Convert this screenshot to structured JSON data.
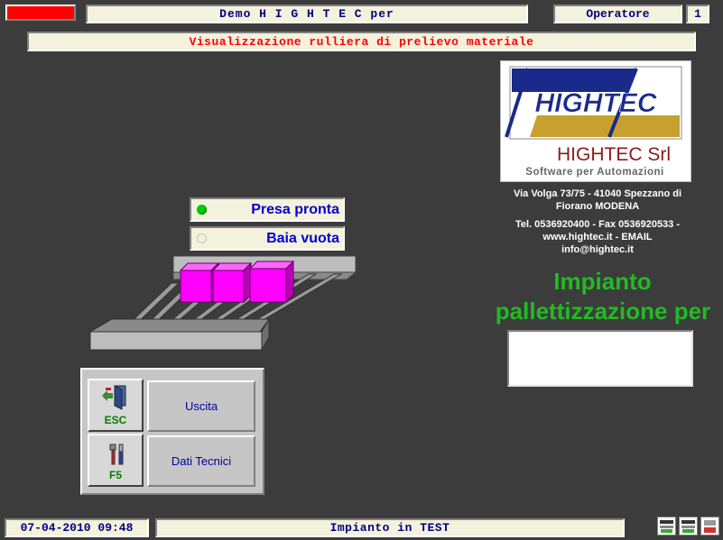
{
  "header": {
    "title": "Demo H I G H T E C per",
    "operator_label": "Operatore",
    "operator_number": "1",
    "subtitle": "Visualizzazione rulliera di prelievo materiale"
  },
  "company": {
    "logo_word": "HIGHTEC",
    "name": "HIGHTEC Srl",
    "tagline": "Software per Automazioni",
    "address_line1": "Via Volga 73/75 - 41040 Spezzano di",
    "address_line2": "Fiorano MODENA",
    "contact_line1": "Tel. 0536920400 - Fax 0536920533 -",
    "contact_line2": "www.hightec.it - EMAIL",
    "contact_line3": "info@hightec.it"
  },
  "plant": {
    "title_line1": "Impianto",
    "title_line2": "pallettizzazione per"
  },
  "status": {
    "presa_label": "Presa pronta",
    "baia_label": "Baia vuota"
  },
  "buttons": {
    "esc_key": "ESC",
    "uscita_label": "Uscita",
    "f5_key": "F5",
    "dati_label": "Dati Tecnici"
  },
  "footer": {
    "datetime": "07-04-2010 09:48",
    "message": "Impianto in TEST"
  },
  "colors": {
    "background": "#3c3c3c",
    "panel": "#f4f1dc",
    "text_blue": "#000080",
    "alert_red": "#ff0000",
    "plant_green": "#22bb22",
    "box_magenta": "#ff00ff",
    "led_on": "#00cc00"
  },
  "icons": {
    "exit_icon": "door-exit-icon",
    "tech_icon": "tools-icon"
  }
}
